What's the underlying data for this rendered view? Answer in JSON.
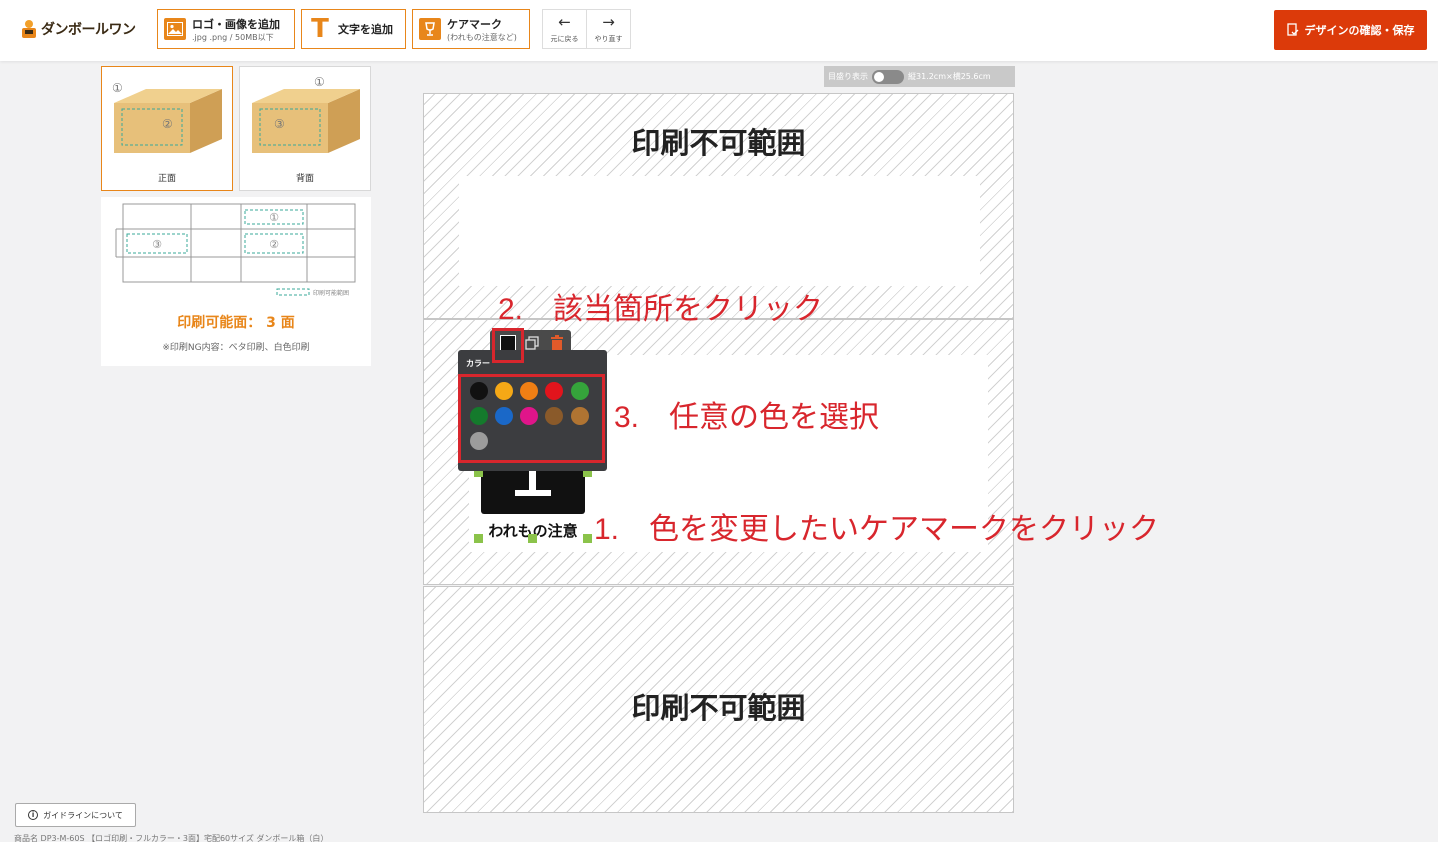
{
  "header": {
    "brand": "ダンボールワン",
    "tools": [
      {
        "label": "ロゴ・画像を追加",
        "sub": ".jpg .png / 50MB以下"
      },
      {
        "label": "文字を追加",
        "sub": ""
      },
      {
        "label": "ケアマーク",
        "sub": "(われもの注意など)"
      }
    ],
    "undo_label": "元に戻る",
    "redo_label": "やり直す",
    "save_label": "デザインの確認・保存"
  },
  "sidebar": {
    "faces": [
      {
        "label": "正面",
        "active": true
      },
      {
        "label": "背面",
        "active": false
      }
    ],
    "legend_label": "印刷可能範囲",
    "print_faces": "印刷可能面： 3 面",
    "ng_note": "※印刷NG内容：ベタ印刷、白色印刷"
  },
  "ruler": {
    "label": "目盛り表示",
    "dimensions": "縦31.2cm×横25.6cm"
  },
  "canvas": {
    "no_print_top": "印刷不可範囲",
    "no_print_bottom": "印刷不可範囲"
  },
  "care_mark": {
    "text": "われもの注意"
  },
  "palette": {
    "title": "カラー",
    "colors": [
      "#111111",
      "#f5a816",
      "#f07f14",
      "#e2141c",
      "#35a43b",
      "#147a2c",
      "#1a68c8",
      "#e0158a",
      "#8a5a2a",
      "#b07432",
      "#9c9c9c"
    ]
  },
  "annotations": {
    "step1": "1.　色を変更したいケアマークをクリック",
    "step2": "2.　該当箇所をクリック",
    "step3": "3.　任意の色を選択"
  },
  "footer": {
    "guide_label": "ガイドラインについて",
    "info_icon": "i",
    "product": "商品名 DP3-M-60S 【ロゴ印刷・フルカラー・3面】宅配60サイズ ダンボール箱（白）"
  }
}
